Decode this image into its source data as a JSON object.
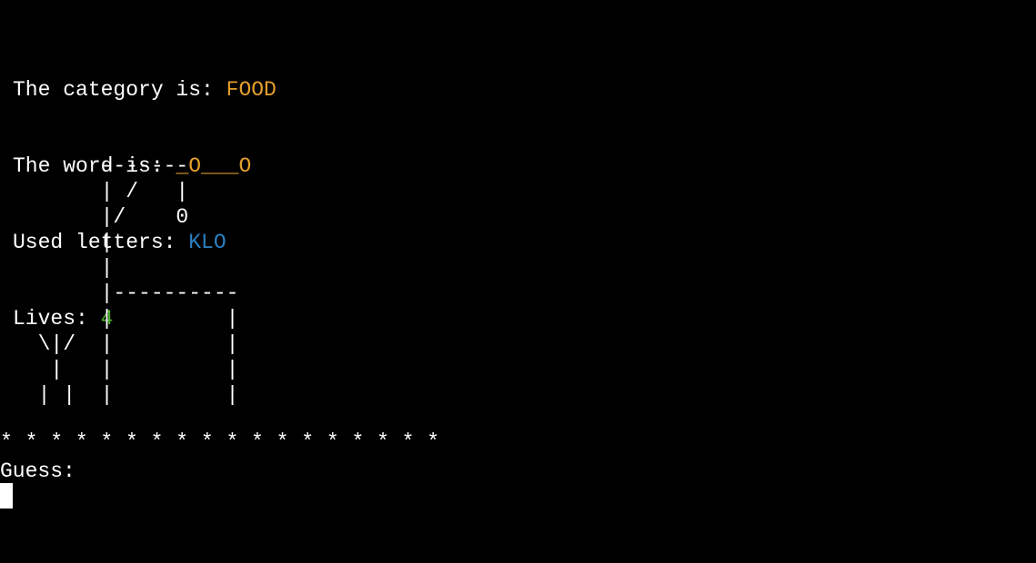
{
  "status": {
    "category_label": "The category is: ",
    "category_value": "FOOD",
    "word_label": "The word is: ",
    "word_value": "_O___O",
    "used_label": "Used letters: ",
    "used_value": "KLO",
    "lives_label": "Lives: ",
    "lives_value": "4"
  },
  "gallows_art": "       -------\n       | /   |\n       |/    0\n       |\n       |\n       |----------\n       |         |\n  \\|/  |         |\n   |   |         |\n  | |  |         |",
  "divider": "* * * * * * * * * * * * * * * * * *",
  "prompt": {
    "label": "Guess:"
  },
  "colors": {
    "background": "#000000",
    "text": "#ffffff",
    "category": "#e5a02c",
    "word": "#e5a02c",
    "used_letters": "#2c7fbf",
    "lives": "#4caf2a"
  }
}
